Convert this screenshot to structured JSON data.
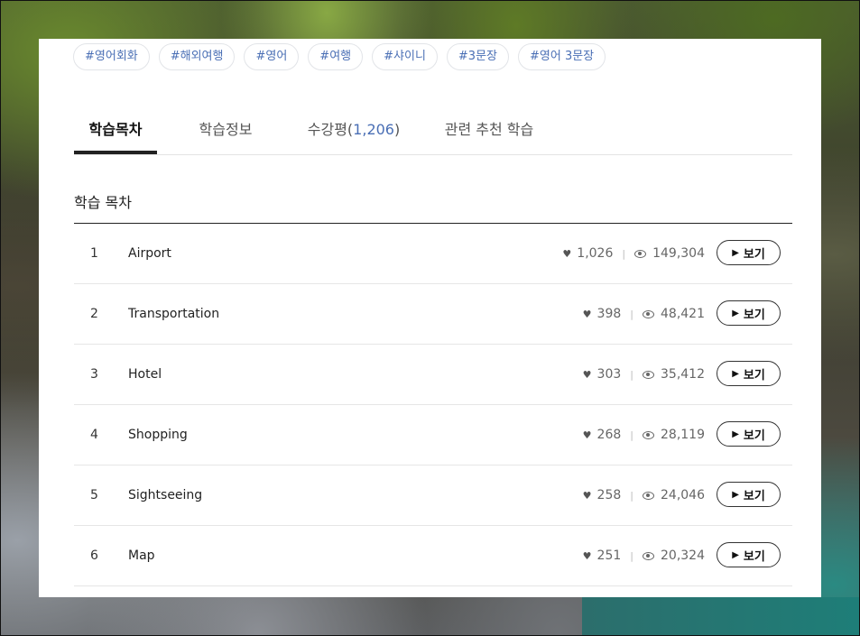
{
  "tags": [
    "#영어회화",
    "#해외여행",
    "#영어",
    "#여행",
    "#샤이니",
    "#3문장",
    "#영어 3문장"
  ],
  "tabs": {
    "contents": "학습목차",
    "info": "학습정보",
    "reviews_label": "수강평(",
    "reviews_count": "1,206",
    "reviews_close": ")",
    "related": "관련 추천 학습"
  },
  "section_title": "학습 목차",
  "view_label": "보기",
  "lessons": [
    {
      "num": "1",
      "title": "Airport",
      "likes": "1,026",
      "views": "149,304"
    },
    {
      "num": "2",
      "title": "Transportation",
      "likes": "398",
      "views": "48,421"
    },
    {
      "num": "3",
      "title": "Hotel",
      "likes": "303",
      "views": "35,412"
    },
    {
      "num": "4",
      "title": "Shopping",
      "likes": "268",
      "views": "28,119"
    },
    {
      "num": "5",
      "title": "Sightseeing",
      "likes": "258",
      "views": "24,046"
    },
    {
      "num": "6",
      "title": "Map",
      "likes": "251",
      "views": "20,324"
    }
  ]
}
